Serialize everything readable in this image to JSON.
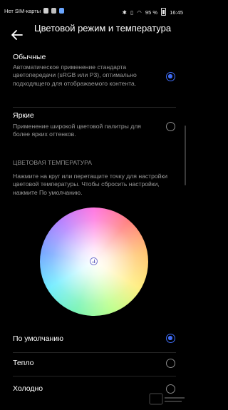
{
  "status_bar": {
    "sim_text": "Нет SIM-карты",
    "battery_text": "95 %",
    "time": "16:45"
  },
  "header": {
    "title": "Цветовой режим и температура"
  },
  "color_mode": {
    "options": [
      {
        "title": "Обычные",
        "description": "Автоматическое применение стандарта цветопередачи (sRGB или P3), оптимально подходящего для отображаемого контента.",
        "selected": true
      },
      {
        "title": "Яркие",
        "description": "Применение широкой цветовой палитры для более ярких оттенков.",
        "selected": false
      }
    ]
  },
  "color_temperature": {
    "section_title": "ЦВЕТОВАЯ ТЕМПЕРАТУРА",
    "description": "Нажмите на круг или перетащите точку для настройки цветовой температуры. Чтобы сбросить настройки, нажмите По умолчанию.",
    "options": [
      {
        "label": "По умолчанию",
        "selected": true
      },
      {
        "label": "Тепло",
        "selected": false
      },
      {
        "label": "Холодно",
        "selected": false
      }
    ]
  },
  "icons": {
    "back": "arrow-left-icon",
    "picker": "crosshair-icon"
  },
  "colors": {
    "accent": "#3f6cf5",
    "background": "#000000",
    "secondary_text": "#9a9a9a"
  }
}
